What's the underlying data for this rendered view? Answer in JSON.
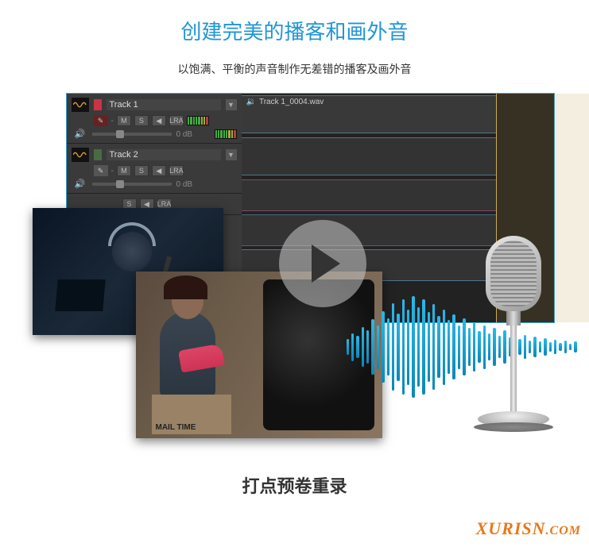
{
  "heading": "创建完美的播客和画外音",
  "subheading": "以饱满、平衡的声音制作无差错的播客及画外音",
  "daw": {
    "tracks": [
      {
        "color": "#cc3344",
        "name": "Track 1",
        "btns": {
          "m": "M",
          "s": "S",
          "spk": "◀",
          "lra": "LRA"
        },
        "db": "0 dB"
      },
      {
        "color": "#4a6a44",
        "name": "Track 2",
        "btns": {
          "m": "M",
          "s": "S",
          "spk": "◀",
          "lra": "LRA"
        },
        "db": "0 dB"
      }
    ],
    "extra_row": {
      "s": "S",
      "spk": "◀",
      "lra": "LRA"
    },
    "clip_name": "Track 1_0004.wav"
  },
  "mailbox": "MAIL\nTIME",
  "bottom_heading": "打点预卷重录",
  "watermark": {
    "main": "XURISN",
    "suffix": ".COM"
  },
  "waveform_heights": [
    20,
    35,
    28,
    50,
    42,
    70,
    55,
    90,
    72,
    110,
    85,
    120,
    95,
    128,
    100,
    120,
    88,
    108,
    78,
    95,
    68,
    82,
    55,
    72,
    48,
    62,
    40,
    55,
    34,
    48,
    28,
    42,
    24,
    36,
    20,
    30,
    16,
    26,
    14,
    22,
    12,
    18,
    10,
    16,
    8,
    14
  ]
}
